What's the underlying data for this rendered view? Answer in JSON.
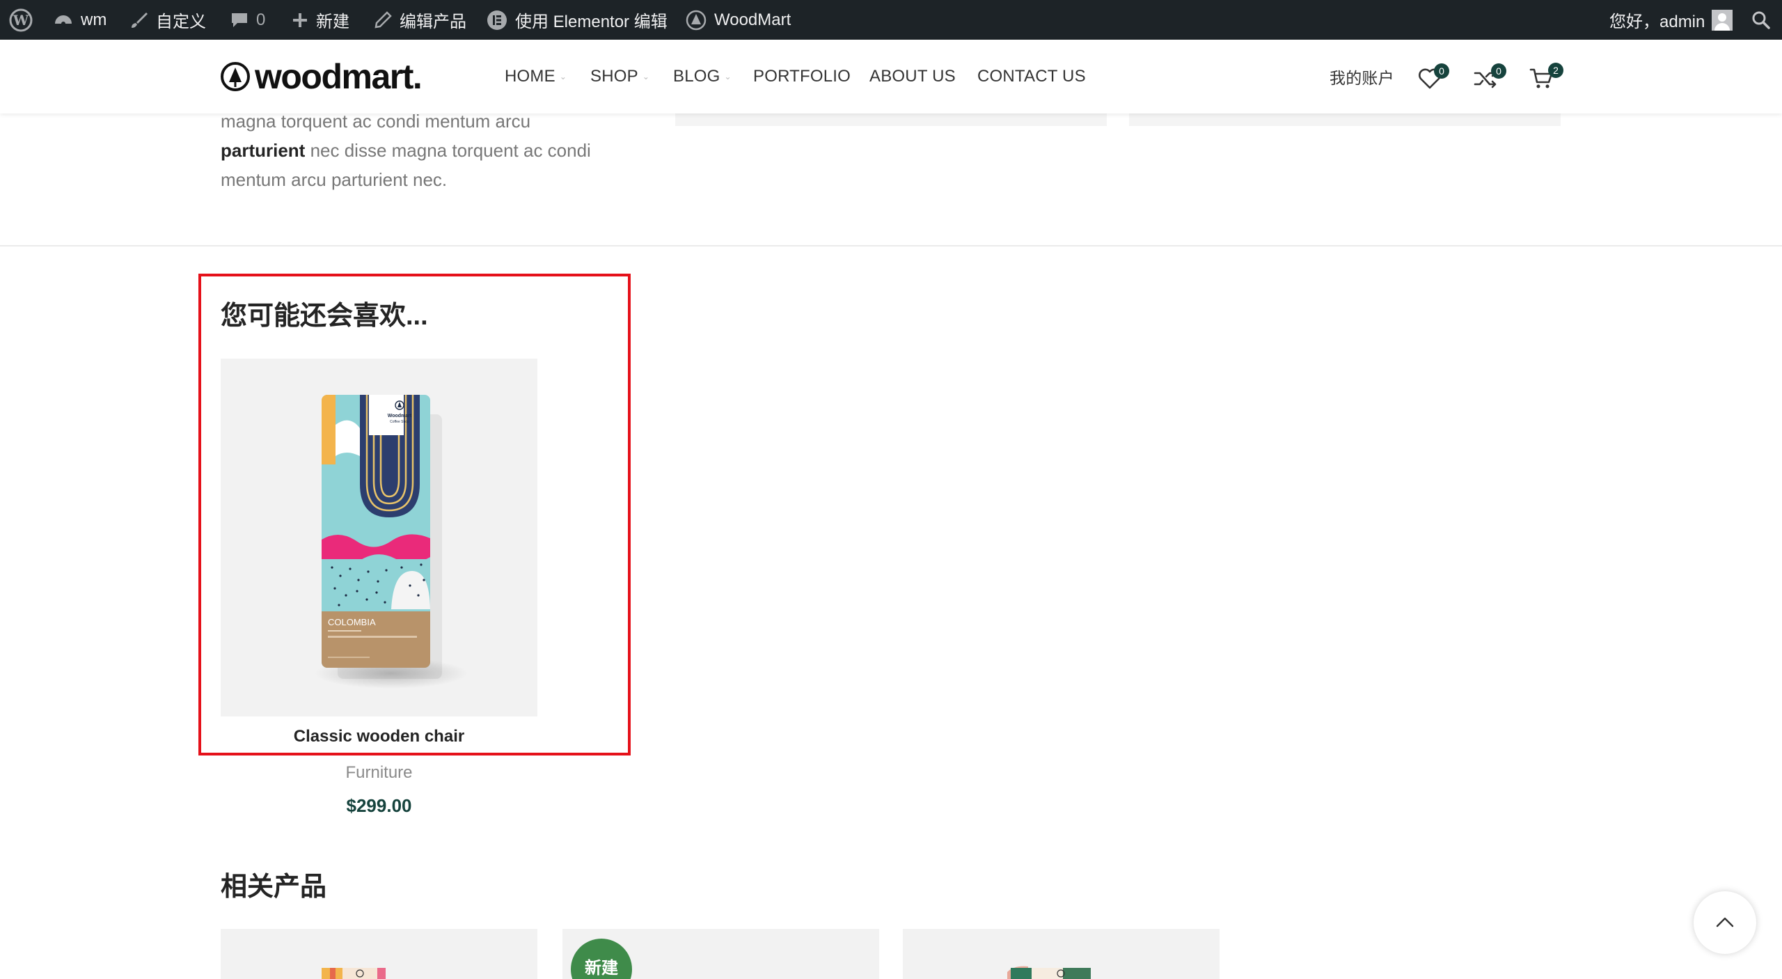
{
  "admin_bar": {
    "site_name": "wm",
    "customize": "自定义",
    "comments_count": "0",
    "new": "新建",
    "edit_product": "编辑产品",
    "elementor": "使用 Elementor 编辑",
    "woodmart": "WoodMart",
    "greeting": "您好，admin"
  },
  "header": {
    "logo": "woodmart.",
    "nav": [
      "HOME",
      "SHOP",
      "BLOG",
      "PORTFOLIO",
      "ABOUT US",
      "CONTACT US"
    ],
    "account": "我的账户",
    "wishlist_count": "0",
    "compare_count": "0",
    "cart_count": "2"
  },
  "description": {
    "line1": "magna torquent ac condi mentum arcu",
    "bold": "parturient",
    "line2_rest": " nec disse magna torquent ac condi",
    "line3": "mentum arcu parturient nec."
  },
  "upsells": {
    "title": "您可能还会喜欢...",
    "product": {
      "name": "Classic wooden chair",
      "category": "Furniture",
      "price": "$299.00",
      "package_brand": "Woodmart",
      "package_sub": "Coffee Shop",
      "package_label": "COLOMBIA"
    }
  },
  "related": {
    "title": "相关产品",
    "new_badge": "新建"
  },
  "colors": {
    "admin_bar_bg": "#1d2327",
    "accent_green": "#16433d",
    "highlight_red": "#e5111a",
    "badge_green": "#3f8b4a"
  }
}
